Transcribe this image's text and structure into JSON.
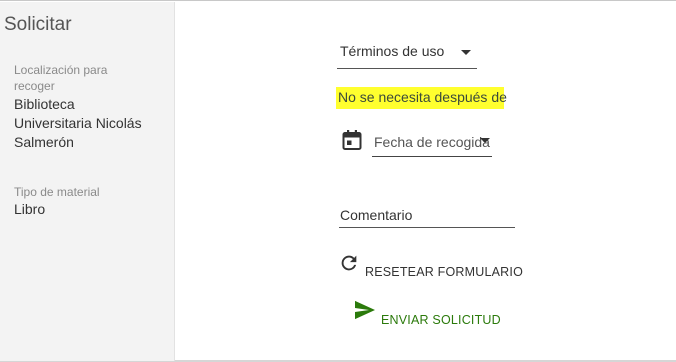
{
  "sidebar": {
    "title": "Solicitar",
    "pickup": {
      "label_line1": "Localización para",
      "label_line2": "recoger",
      "value_line1": "Biblioteca",
      "value_line2": "Universitaria Nicolás",
      "value_line3": "Salmerón"
    },
    "material": {
      "label": "Tipo de material",
      "value": "Libro"
    }
  },
  "form": {
    "terms_select": {
      "value": "Términos de uso",
      "icon": "chevron-down-icon"
    },
    "not_needed_after": "No se necesita después de",
    "pickup_date": {
      "placeholder": "Fecha de recogida",
      "icon": "calendar-icon"
    },
    "comment": {
      "placeholder": "Comentario"
    },
    "reset_button": {
      "label": "RESETEAR FORMULARIO",
      "icon": "refresh-icon"
    },
    "send_button": {
      "label": "ENVIAR SOLICITUD",
      "icon": "send-icon"
    }
  },
  "colors": {
    "highlight": "#ffff2e",
    "send_accent": "#2b7a0b",
    "sidebar_bg": "#f3f3f3"
  }
}
